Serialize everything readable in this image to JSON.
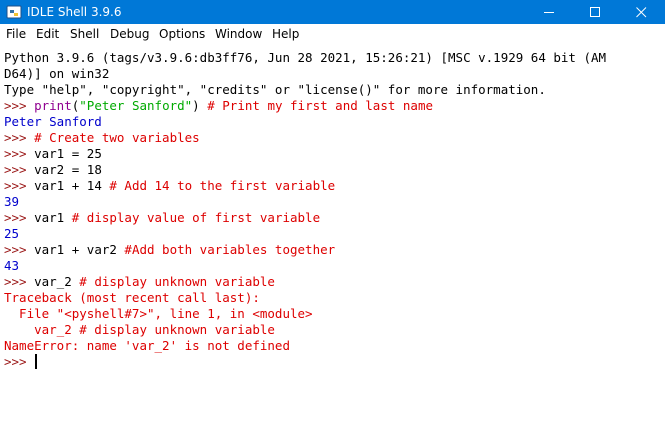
{
  "window": {
    "title": "IDLE Shell 3.9.6",
    "icon": "python-idle-icon"
  },
  "window_controls": {
    "minimize": "minimize-icon",
    "maximize": "maximize-icon",
    "close": "close-icon"
  },
  "menu": [
    "File",
    "Edit",
    "Shell",
    "Debug",
    "Options",
    "Window",
    "Help"
  ],
  "colors": {
    "titlebar": "#0078d7",
    "prompt": "#9a1616",
    "builtin": "#900090",
    "string": "#00aa00",
    "comment": "#dd0000",
    "output": "#0000cc",
    "error": "#dd0000"
  },
  "shell": {
    "banner_1": "Python 3.9.6 (tags/v3.9.6:db3ff76, Jun 28 2021, 15:26:21) [MSC v.1929 64 bit (AM",
    "banner_2": "D64)] on win32",
    "banner_3": "Type \"help\", \"copyright\", \"credits\" or \"license()\" for more information.",
    "prompt": ">>> ",
    "cmd_1": {
      "builtin": "print",
      "open": "(",
      "string": "\"Peter Sanford\"",
      "close": ") ",
      "comment": "# Print my first and last name"
    },
    "out_1": "Peter Sanford",
    "cmd_2": {
      "comment": "# Create two variables"
    },
    "cmd_3": "var1 = 25",
    "cmd_4": "var2 = 18",
    "cmd_5": {
      "code": "var1 + 14 ",
      "comment": "# Add 14 to the first variable"
    },
    "out_5": "39",
    "cmd_6": {
      "code": "var1 ",
      "comment": "# display value of first variable"
    },
    "out_6": "25",
    "cmd_7": {
      "code": "var1 + var2 ",
      "comment": "#Add both variables together"
    },
    "out_7": "43",
    "cmd_8": {
      "code": "var_2 ",
      "comment": "# display unknown variable"
    },
    "tb_1": "Traceback (most recent call last):",
    "tb_2": "  File \"<pyshell#7>\", line 1, in <module>",
    "tb_3": "    var_2 # display unknown variable",
    "tb_4": "NameError: name 'var_2' is not defined"
  }
}
